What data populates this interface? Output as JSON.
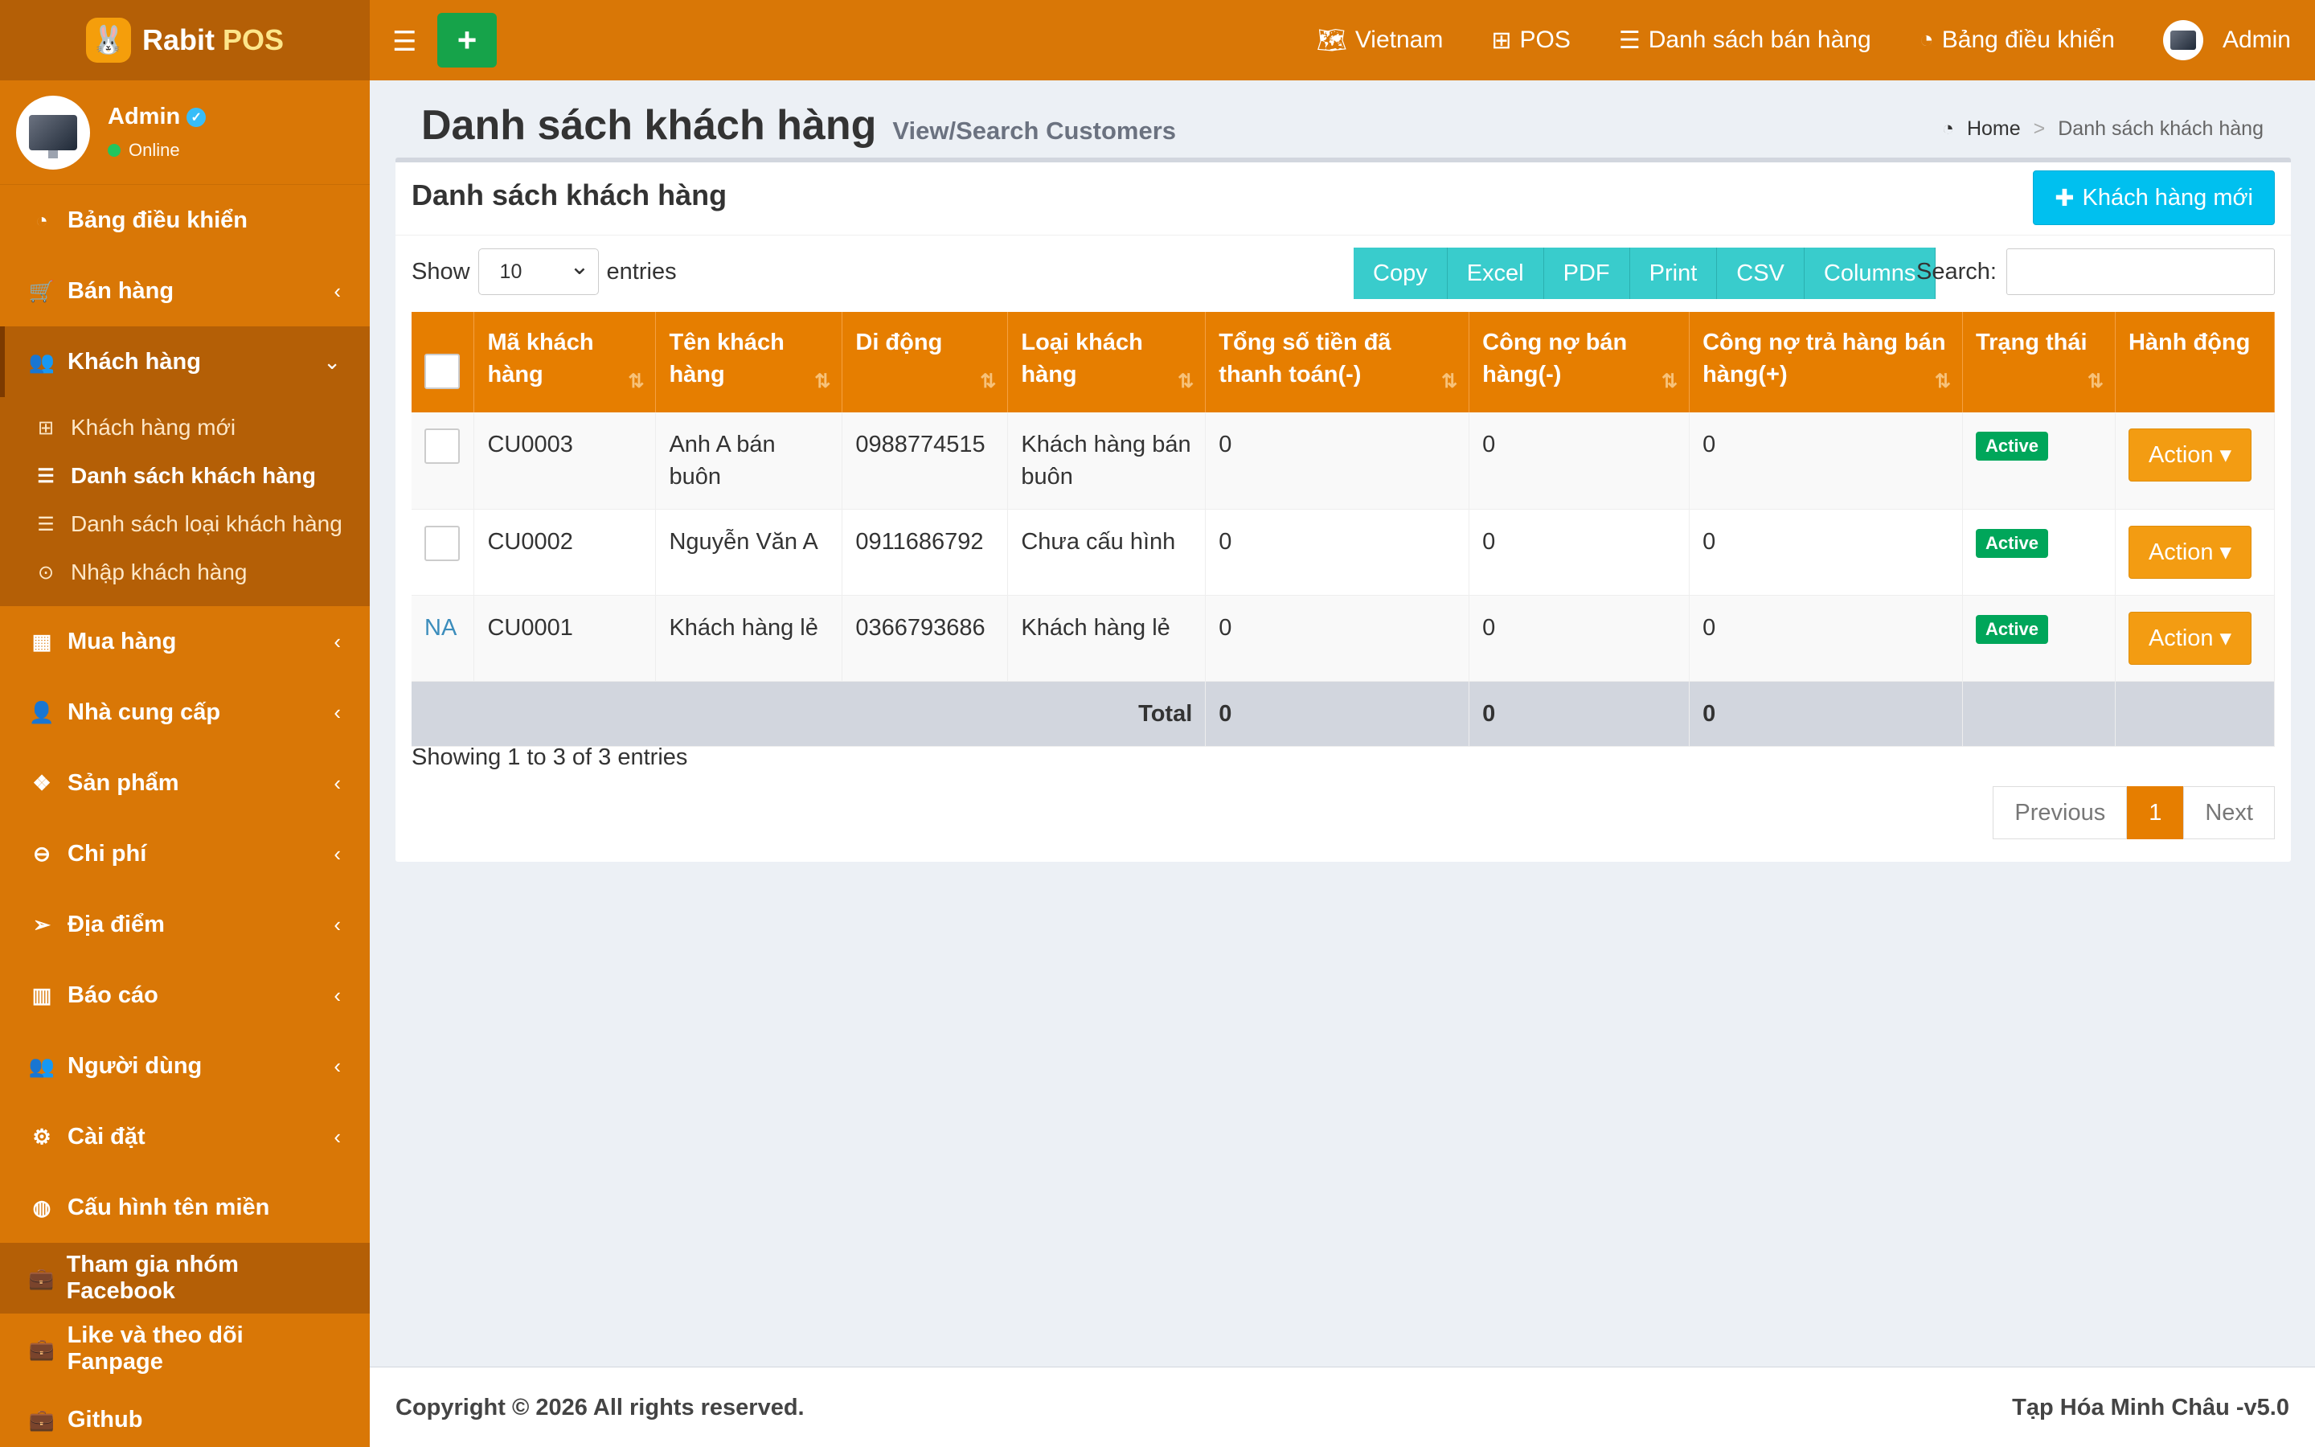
{
  "app": {
    "logo_rabit": "Rabit",
    "logo_pos": "POS"
  },
  "user": {
    "name": "Admin",
    "status": "Online"
  },
  "sidebar": {
    "items": [
      {
        "label": "Bảng điều khiển"
      },
      {
        "label": "Bán hàng"
      },
      {
        "label": "Khách hàng"
      },
      {
        "label": "Mua hàng"
      },
      {
        "label": "Nhà cung cấp"
      },
      {
        "label": "Sản phẩm"
      },
      {
        "label": "Chi phí"
      },
      {
        "label": "Địa điểm"
      },
      {
        "label": "Báo cáo"
      },
      {
        "label": "Người dùng"
      },
      {
        "label": "Cài đặt"
      },
      {
        "label": "Cấu hình tên miền"
      },
      {
        "label": "Tham gia nhóm Facebook"
      },
      {
        "label": "Like và theo dõi Fanpage"
      },
      {
        "label": "Github"
      }
    ],
    "customers_sub": [
      {
        "label": "Khách hàng mới"
      },
      {
        "label": "Danh sách khách hàng"
      },
      {
        "label": "Danh sách loại khách hàng"
      },
      {
        "label": "Nhập khách hàng"
      }
    ]
  },
  "navbar": {
    "language": "Vietnam",
    "pos": "POS",
    "sales_list": "Danh sách bán hàng",
    "dashboard": "Bảng điều khiển",
    "user": "Admin"
  },
  "page": {
    "title": "Danh sách khách hàng",
    "subtitle": "View/Search Customers",
    "breadcrumb_home": "Home",
    "breadcrumb_current": "Danh sách khách hàng"
  },
  "box": {
    "title": "Danh sách khách hàng",
    "new_button": "Khách hàng mới",
    "show_label": "Show",
    "entries_value": "10",
    "entries_label": "entries",
    "search_label": "Search:",
    "search_value": "",
    "export_buttons": [
      "Copy",
      "Excel",
      "PDF",
      "Print",
      "CSV",
      "Columns"
    ]
  },
  "table": {
    "headers": [
      "Mã khách hàng",
      "Tên khách hàng",
      "Di động",
      "Loại khách hàng",
      "Tổng số tiền đã thanh toán(-)",
      "Công nợ bán hàng(-)",
      "Công nợ trả hàng bán hàng(+)",
      "Trạng thái",
      "Hành động"
    ],
    "rows": [
      {
        "select": "",
        "code": "CU0003",
        "name": "Anh A bán buôn",
        "mobile": "0988774515",
        "type": "Khách hàng bán buôn",
        "paid": "0",
        "sales_debt": "0",
        "return_debt": "0",
        "status": "Active",
        "action": "Action"
      },
      {
        "select": "",
        "code": "CU0002",
        "name": "Nguyễn Văn A",
        "mobile": "0911686792",
        "type": "Chưa cấu hình",
        "paid": "0",
        "sales_debt": "0",
        "return_debt": "0",
        "status": "Active",
        "action": "Action"
      },
      {
        "select": "NA",
        "code": "CU0001",
        "name": "Khách hàng lẻ",
        "mobile": "0366793686",
        "type": "Khách hàng lẻ",
        "paid": "0",
        "sales_debt": "0",
        "return_debt": "0",
        "status": "Active",
        "action": "Action"
      }
    ],
    "footer": {
      "label": "Total",
      "paid": "0",
      "sales_debt": "0",
      "return_debt": "0"
    }
  },
  "pagination": {
    "info": "Showing 1 to 3 of 3 entries",
    "previous": "Previous",
    "current": "1",
    "next": "Next"
  },
  "footer": {
    "copyright": "Copyright © 2026 All rights reserved.",
    "store": "Tạp Hóa Minh Châu -v5.0"
  },
  "icons": {
    "sidebar": [
      "dashboard-icon",
      "cart-icon",
      "users-icon",
      "grid-icon",
      "user-plus-icon",
      "cubes-icon",
      "minus-circle-icon",
      "paper-plane-icon",
      "bar-chart-icon",
      "users-icon",
      "cogs-icon",
      "globe-icon",
      "briefcase-icon",
      "briefcase-icon",
      "briefcase-icon"
    ]
  },
  "colors": {
    "primary": "#d97706",
    "dark": "#b45f06",
    "table_header": "#e67e00",
    "info_button": "#00c0ef",
    "export_button": "#39cccc",
    "active_badge": "#00a65a",
    "action_button": "#f39c12",
    "add_button": "#16a34a"
  }
}
